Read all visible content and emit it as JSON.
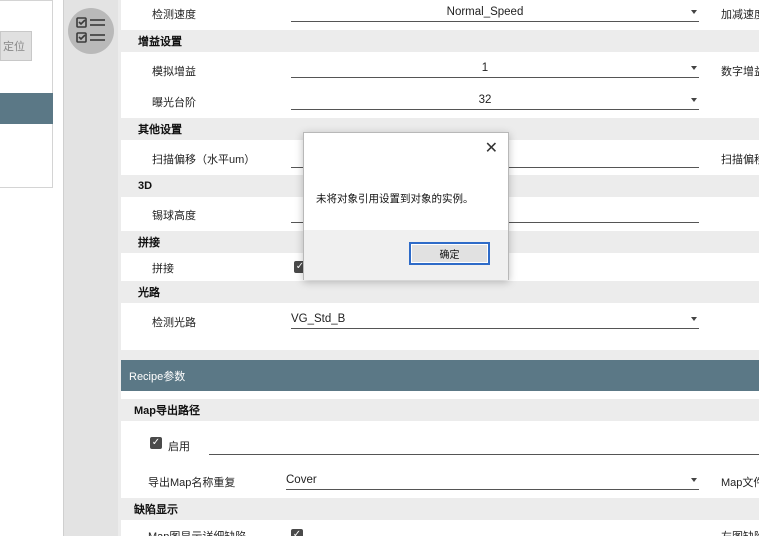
{
  "left": {
    "button_label": "定位"
  },
  "settings": {
    "rows": {
      "detect_speed": {
        "label": "检测速度",
        "value": "Normal_Speed",
        "right_label": "加减速度"
      },
      "analog_gain": {
        "label": "模拟增益",
        "value": "1",
        "right_label": "数字增益"
      },
      "exposure_steps": {
        "label": "曝光台阶",
        "value": "32"
      },
      "scan_offset": {
        "label": "扫描偏移（水平um）",
        "right_label": "扫描偏移"
      },
      "bump_height": {
        "label": "锡球高度"
      },
      "stitch": {
        "label": "拼接",
        "checked": true
      },
      "detect_light_path": {
        "label": "检测光路",
        "value": "VG_Std_B"
      }
    },
    "sections": {
      "gain": "增益设置",
      "other": "其他设置",
      "three_d": "3D",
      "stitch": "拼接",
      "light_path": "光路"
    }
  },
  "recipe": {
    "header": "Recipe参数",
    "map_export": {
      "section": "Map导出路径",
      "enable_label": "启用",
      "enable_checked": true,
      "name_dup_label": "导出Map名称重复",
      "name_dup_value": "Cover",
      "right_label": "Map文件"
    },
    "defect_section": "缺陷显示",
    "defect_row_label": "Map图显示详细缺陷",
    "defect_row_checked": true,
    "defect_right_label": "左图缺陷"
  },
  "dialog": {
    "message": "未将对象引用设置到对象的实例。",
    "ok_label": "确定",
    "close_symbol": "✕"
  },
  "colors": {
    "accent": "#5b7886",
    "dialog_focus": "#2e6bc8"
  }
}
